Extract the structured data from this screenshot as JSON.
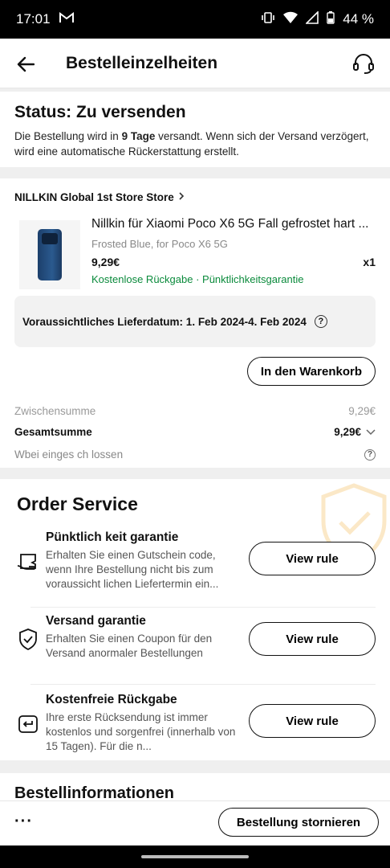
{
  "status_bar": {
    "time": "17:01",
    "battery": "44 %"
  },
  "header": {
    "title": "Bestelleinzelheiten"
  },
  "status": {
    "title": "Status: Zu versenden",
    "text_before": "Die Bestellung wird in ",
    "text_bold": "9 Tage",
    "text_after": " versandt. Wenn sich der Versand verzögert, wird eine automatische Rückerstattung erstellt."
  },
  "order": {
    "store": "NILLKIN Global 1st Store Store",
    "product_name": "Nillkin für Xiaomi Poco X6 5G Fall gefrostet hart ...",
    "variant": "Frosted Blue, for Poco X6 5G",
    "price": "9,29€",
    "qty": "x1",
    "tags": "Kostenlose Rückgabe · Pünktlichkeitsgarantie",
    "delivery": "Voraussichtliches Lieferdatum: 1. Feb 2024-4. Feb 2024",
    "cart_button": "In den Warenkorb",
    "subtotal_label": "Zwischensumme",
    "subtotal_value": "9,29€",
    "total_label": "Gesamtsumme",
    "total_value": "9,29€",
    "savings_label": "Wbei einges ch lossen"
  },
  "service": {
    "title": "Order Service",
    "items": [
      {
        "title": "Pünktlich keit garantie",
        "desc": "Erhalten Sie einen Gutschein code, wenn Ihre Bestellung nicht bis zum voraussicht lichen Liefertermin ein...",
        "button": "View rule",
        "icon": "voucher-icon"
      },
      {
        "title": "Versand garantie",
        "desc": "Erhalten Sie einen Coupon für den Versand anormaler Bestellungen",
        "button": "View rule",
        "icon": "shield-check-icon"
      },
      {
        "title": "Kostenfreie Rückgabe",
        "desc": "Ihre erste Rücksendung ist immer kostenlos und sorgenfrei (innerhalb von 15 Tagen). Für die n...",
        "button": "View rule",
        "icon": "return-icon"
      }
    ]
  },
  "info": {
    "title": "Bestellinformationen"
  },
  "bottom": {
    "more": "···",
    "cancel_button": "Bestellung stornieren"
  }
}
